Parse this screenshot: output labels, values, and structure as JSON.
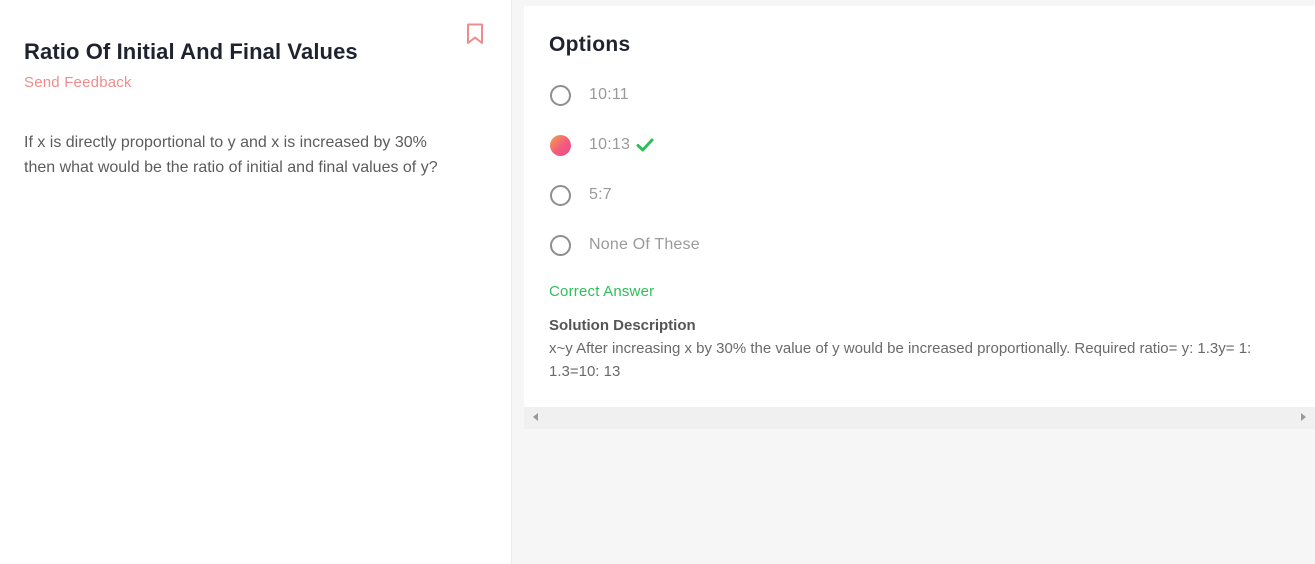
{
  "question": {
    "title": "Ratio Of Initial And Final Values",
    "feedback_label": "Send Feedback",
    "text": "If x is directly proportional to y and x is increased by 30% then what would be the ratio of initial and final values of y?",
    "bookmark_icon": "bookmark-icon"
  },
  "options_panel": {
    "heading": "Options",
    "options": [
      {
        "label": "10:11",
        "selected": false,
        "correct": false
      },
      {
        "label": "10:13",
        "selected": true,
        "correct": true
      },
      {
        "label": "5:7",
        "selected": false,
        "correct": false
      },
      {
        "label": "None Of These",
        "selected": false,
        "correct": false
      }
    ],
    "correct_answer_label": "Correct Answer",
    "solution_heading": "Solution Description",
    "solution_text": "x~y After increasing x by 30% the value of y would be increased proportionally. Required ratio= y: 1.3y= 1: 1.3=10: 13"
  },
  "colors": {
    "accent_pink": "#f08c8c",
    "correct_green": "#2fbf5a",
    "title_dark": "#1f2330"
  }
}
